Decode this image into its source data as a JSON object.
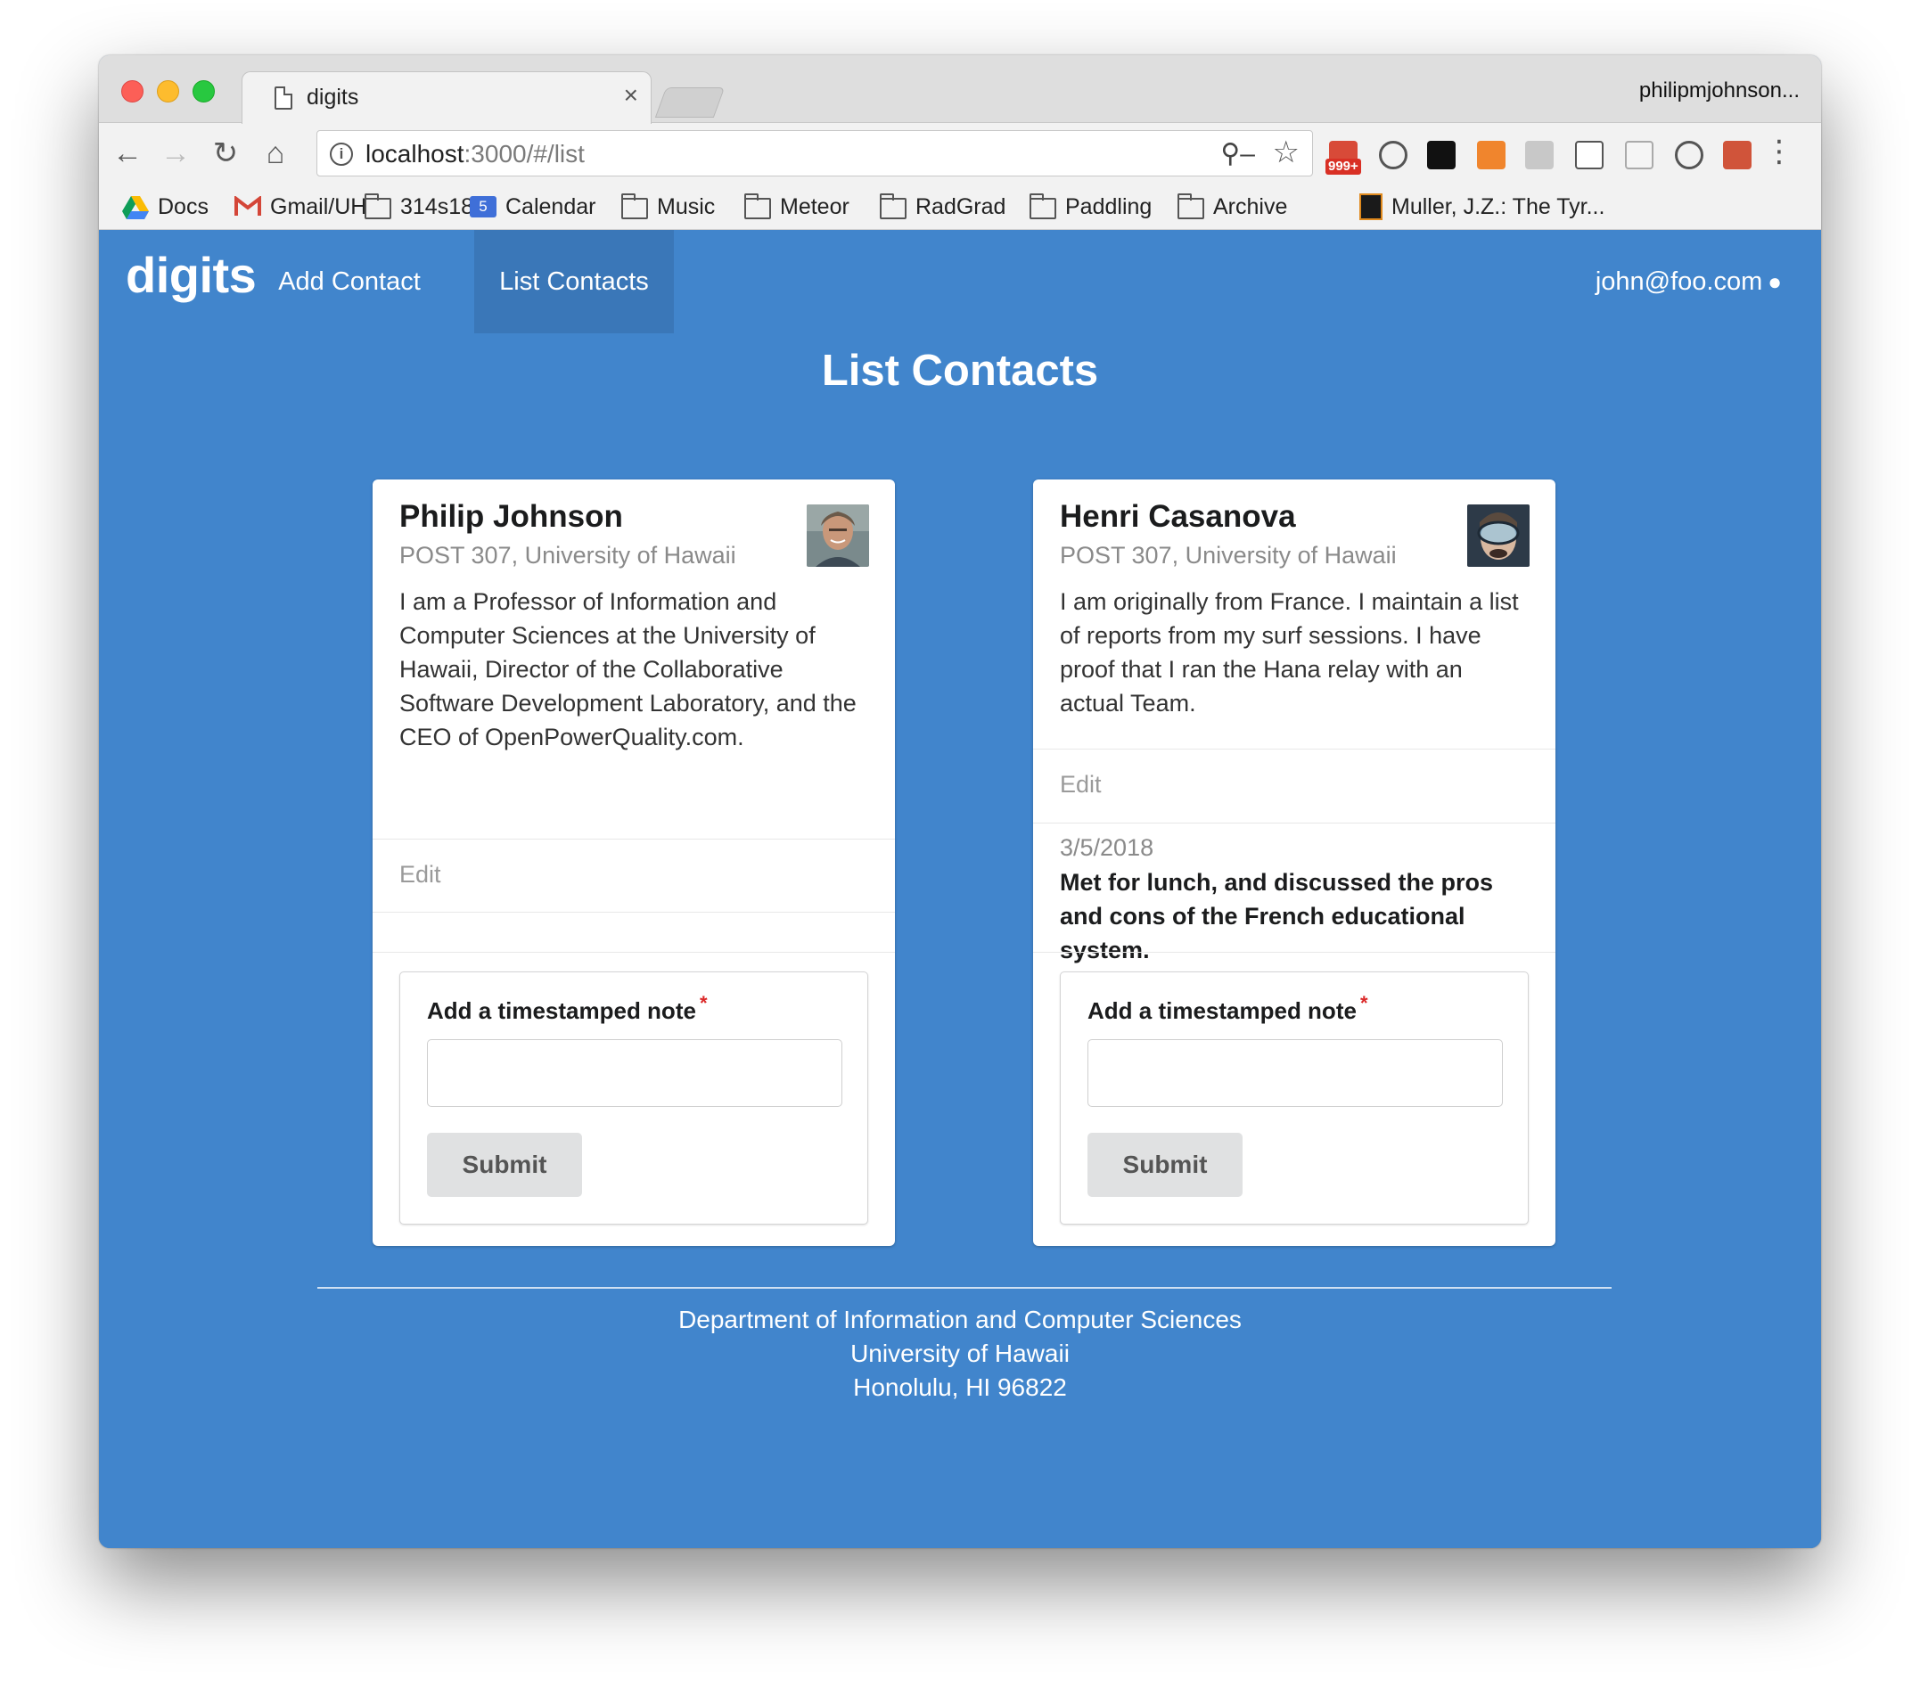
{
  "browser": {
    "tab_title": "digits",
    "tab_close": "×",
    "profile_name": "philipmjohnson...",
    "url_host": "localhost",
    "url_rest": ":3000/#/list",
    "extension_badge": "999+",
    "bookmarks": [
      {
        "label": "Docs",
        "icon": "google-drive-icon"
      },
      {
        "label": "Gmail/UH",
        "icon": "gmail-icon"
      },
      {
        "label": "314s18",
        "icon": "folder-icon"
      },
      {
        "label": "Calendar",
        "icon": "calendar-icon",
        "icon_text": "5"
      },
      {
        "label": "Music",
        "icon": "folder-icon"
      },
      {
        "label": "Meteor",
        "icon": "folder-icon"
      },
      {
        "label": "RadGrad",
        "icon": "folder-icon"
      },
      {
        "label": "Paddling",
        "icon": "folder-icon"
      },
      {
        "label": "Archive",
        "icon": "folder-icon"
      },
      {
        "label": "Muller, J.Z.: The Tyr...",
        "icon": "book-icon"
      }
    ]
  },
  "navbar": {
    "brand": "digits",
    "items": [
      {
        "label": "Add Contact",
        "active": false
      },
      {
        "label": "List Contacts",
        "active": true
      }
    ],
    "user": "john@foo.com"
  },
  "page": {
    "title": "List Contacts"
  },
  "contacts": [
    {
      "name": "Philip Johnson",
      "address": "POST 307, University of Hawaii",
      "description": "I am a Professor of Information and Computer Sciences at the University of Hawaii, Director of the Collaborative Software Development Laboratory, and the CEO of OpenPowerQuality.com.",
      "edit_label": "Edit",
      "notes": [],
      "form": {
        "label": "Add a timestamped note",
        "required_mark": "*",
        "input_value": "",
        "submit_label": "Submit"
      }
    },
    {
      "name": "Henri Casanova",
      "address": "POST 307, University of Hawaii",
      "description": "I am originally from France. I maintain a list of reports from my surf sessions. I have proof that I ran the Hana relay with an actual Team.",
      "edit_label": "Edit",
      "notes": [
        {
          "date": "3/5/2018",
          "text": "Met for lunch, and discussed the pros and cons of the French educational system."
        }
      ],
      "form": {
        "label": "Add a timestamped note",
        "required_mark": "*",
        "input_value": "",
        "submit_label": "Submit"
      }
    }
  ],
  "footer": {
    "line1": "Department of Information and Computer Sciences",
    "line2": "University of Hawaii",
    "line3": "Honolulu, HI 96822"
  },
  "colors": {
    "app_background": "#4185cc",
    "active_nav": "#3a77b8",
    "card_background": "#ffffff",
    "required": "#db2828",
    "button_background": "#e0e1e2"
  }
}
